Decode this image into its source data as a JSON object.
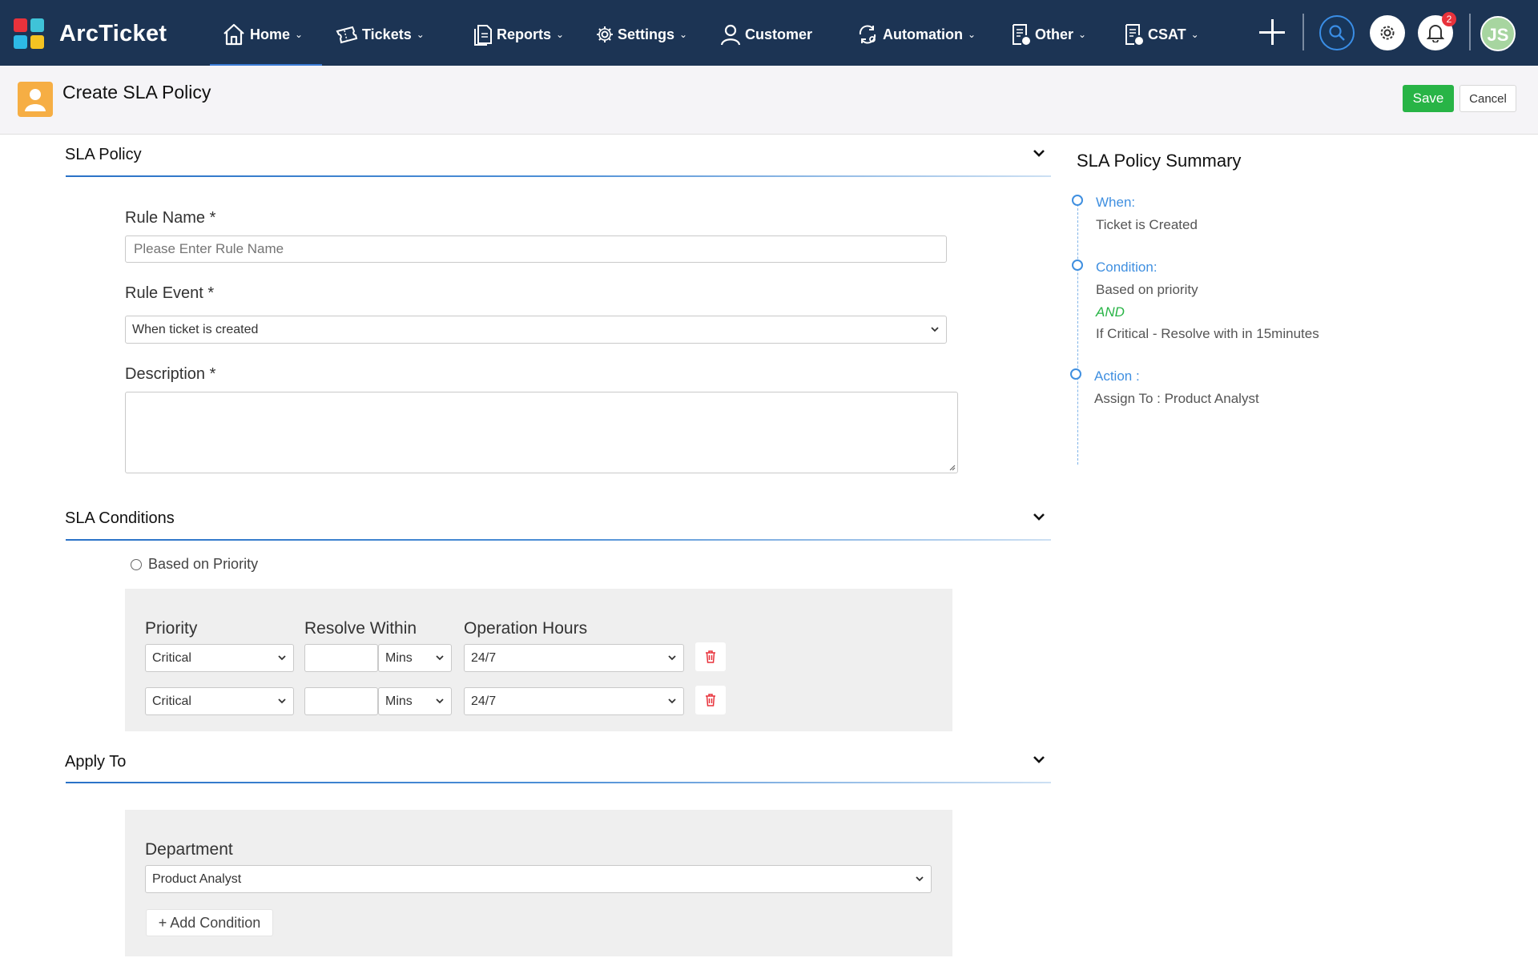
{
  "app": {
    "brand": "ArcTicket"
  },
  "nav": {
    "home": "Home",
    "tickets": "Tickets",
    "reports": "Reports",
    "settings": "Settings",
    "customer": "Customer",
    "automation": "Automation",
    "other": "Other",
    "csat": "CSAT",
    "notification_count": "2",
    "user_initials": "JS"
  },
  "header": {
    "title": "Create SLA Policy",
    "save_label": "Save",
    "cancel_label": "Cancel"
  },
  "sla_policy": {
    "section_title": "SLA Policy",
    "rule_name_label": "Rule Name *",
    "rule_name_placeholder": "Please Enter Rule Name",
    "rule_event_label": "Rule Event *",
    "rule_event_value": "When ticket is created",
    "description_label": "Description *"
  },
  "sla_conditions": {
    "section_title": "SLA Conditions",
    "radio_label": "Based on Priority",
    "col_priority": "Priority",
    "col_resolve": "Resolve Within",
    "col_hours": "Operation Hours",
    "rows": [
      {
        "priority": "Critical",
        "unit": "Mins",
        "hours": "24/7"
      },
      {
        "priority": "Critical",
        "unit": "Mins",
        "hours": "24/7"
      }
    ]
  },
  "apply_to": {
    "section_title": "Apply To",
    "department_label": "Department",
    "department_value": "Product Analyst",
    "add_condition_label": "+ Add Condition"
  },
  "summary": {
    "title": "SLA Policy Summary",
    "when_label": "When:",
    "when_value": "Ticket is Created",
    "condition_label": "Condition:",
    "condition_value": "Based on priority",
    "and_label": "AND",
    "condition_detail": "If Critical - Resolve with in 15minutes",
    "action_label": "Action :",
    "action_value": "Assign To : Product Analyst"
  },
  "colors": {
    "nav_bg": "#1c3454",
    "accent_blue": "#3f8fe0",
    "save_green": "#28b446",
    "danger_red": "#e8323b"
  }
}
